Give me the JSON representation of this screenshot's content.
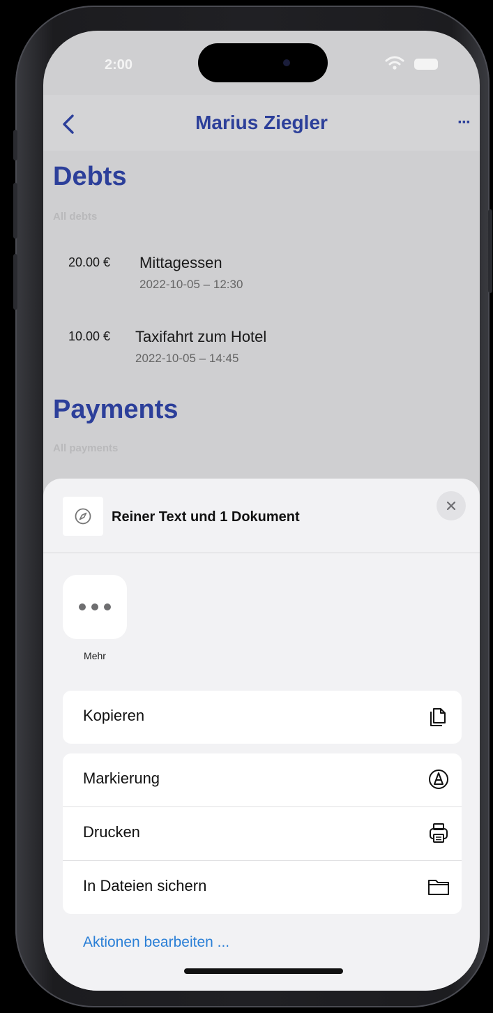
{
  "status_bar": {
    "time": "2:00"
  },
  "nav": {
    "title": "Marius Ziegler",
    "more_label": "···"
  },
  "debts": {
    "title": "Debts",
    "subtitle": "All debts",
    "items": [
      {
        "amount": "20.00 €",
        "name": "Mittagessen",
        "date": "2022-10-05 – 12:30"
      },
      {
        "amount": "10.00 €",
        "name": "Taxifahrt zum Hotel",
        "date": "2022-10-05 – 14:45"
      }
    ]
  },
  "payments": {
    "title": "Payments",
    "subtitle": "All payments"
  },
  "share_sheet": {
    "title": "Reiner Text und 1 Dokument",
    "more_app_label": "Mehr",
    "actions": [
      {
        "label": "Kopieren",
        "icon": "copy-icon"
      },
      {
        "label": "Markierung",
        "icon": "markup-icon"
      },
      {
        "label": "Drucken",
        "icon": "printer-icon"
      },
      {
        "label": "In Dateien sichern",
        "icon": "folder-icon"
      }
    ],
    "edit_actions_label": "Aktionen bearbeiten ..."
  },
  "colors": {
    "accent": "#2c3f9a",
    "link": "#2a7fd6",
    "dimmed_background": "#cfcfd1",
    "sheet_background": "#f2f2f4"
  }
}
